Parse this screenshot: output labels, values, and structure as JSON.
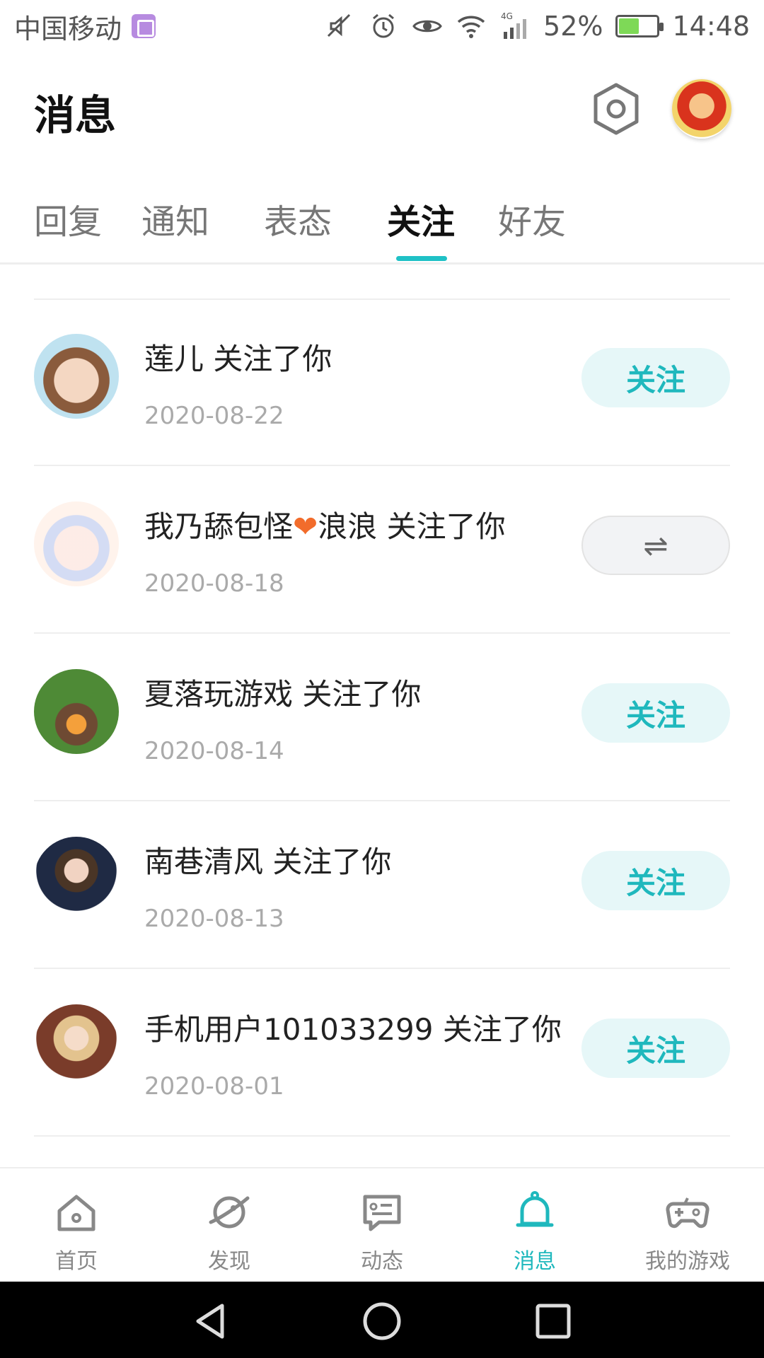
{
  "status_bar": {
    "carrier": "中国移动",
    "battery": "52%",
    "battery_level": 0.52,
    "time": "14:48",
    "network": "4G"
  },
  "header": {
    "title": "消息"
  },
  "tabs": [
    {
      "label": "回复"
    },
    {
      "label": "通知"
    },
    {
      "label": "表态"
    },
    {
      "label": "关注"
    },
    {
      "label": "好友"
    }
  ],
  "active_tab": "关注",
  "items": [
    {
      "name": "莲儿",
      "suffix": " 关注了你",
      "date": "2020-08-22",
      "button": "关注"
    },
    {
      "name_before": "我乃舔包怪",
      "heart": "❤",
      "name_after": "浪浪",
      "suffix": " 关注了你",
      "date": "2020-08-18",
      "button_icon": "⇌"
    },
    {
      "name": "夏落玩游戏",
      "suffix": " 关注了你",
      "date": "2020-08-14",
      "button": "关注"
    },
    {
      "name": "南巷清风",
      "suffix": " 关注了你",
      "date": "2020-08-13",
      "button": "关注"
    },
    {
      "name": "手机用户101033299",
      "suffix": " 关注了你",
      "date": "2020-08-01",
      "button": "关注"
    }
  ],
  "bottom_nav": [
    {
      "label": "首页",
      "icon": "home-icon"
    },
    {
      "label": "发现",
      "icon": "discover-icon"
    },
    {
      "label": "动态",
      "icon": "feed-icon"
    },
    {
      "label": "消息",
      "icon": "bell-icon"
    },
    {
      "label": "我的游戏",
      "icon": "gamepad-icon"
    }
  ],
  "colors": {
    "accent": "#1fb8bd",
    "follow_button_bg": "#e6f7f8",
    "heart": "#f26c2b"
  }
}
